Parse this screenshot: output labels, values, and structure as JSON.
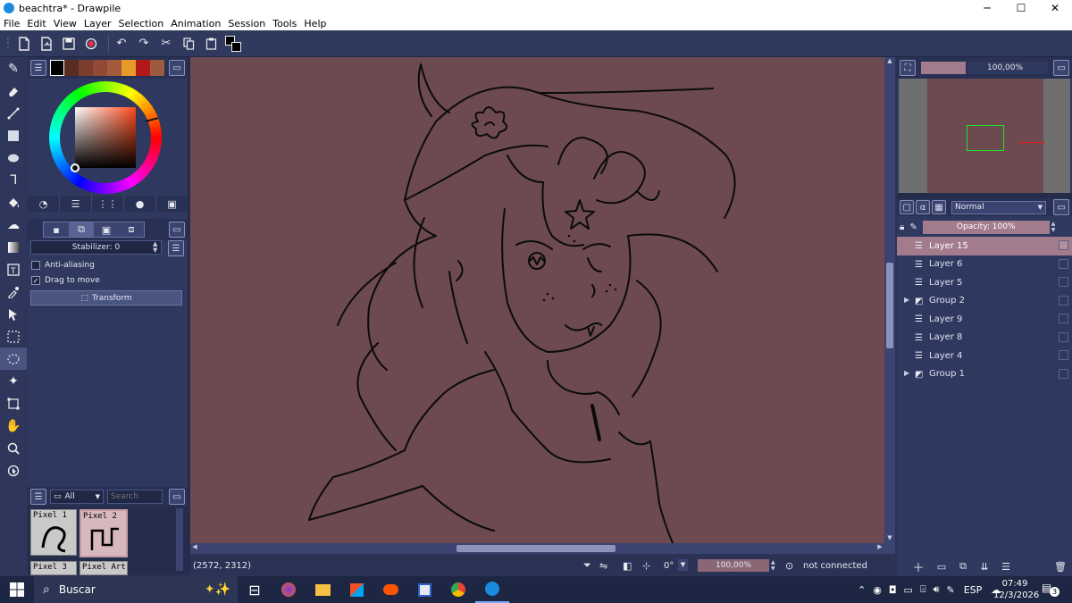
{
  "window": {
    "title": "beachtra* - Drawpile",
    "minimize": "─",
    "maximize": "☐",
    "close": "✕"
  },
  "menu": [
    "File",
    "Edit",
    "View",
    "Layer",
    "Selection",
    "Animation",
    "Session",
    "Tools",
    "Help"
  ],
  "palette_colors": [
    "#000000",
    "#5a2d24",
    "#7a3d2e",
    "#924a36",
    "#a55a3b",
    "#e59a2a",
    "#b31818",
    "#9c5a3e"
  ],
  "brush_panel": {
    "stabilizer": "Stabilizer: 0",
    "anti_aliasing": "Anti-aliasing",
    "drag_to_move": "Drag to move",
    "transform": "Transform"
  },
  "brushes_panel": {
    "filter": "All",
    "search_placeholder": "Search",
    "presets": [
      "Pixel 1",
      "Pixel 2",
      "Pixel 3",
      "Pixel Art"
    ]
  },
  "navigator": {
    "zoom": "100,00%"
  },
  "layers_panel": {
    "blend_mode": "Normal",
    "opacity": "Opacity: 100%",
    "layers": [
      {
        "name": "Layer 15",
        "type": "layer",
        "selected": true
      },
      {
        "name": "Layer 6",
        "type": "layer",
        "selected": false
      },
      {
        "name": "Layer 5",
        "type": "layer",
        "selected": false
      },
      {
        "name": "Group 2",
        "type": "group",
        "selected": false
      },
      {
        "name": "Layer 9",
        "type": "layer",
        "selected": false
      },
      {
        "name": "Layer 8",
        "type": "layer",
        "selected": false
      },
      {
        "name": "Layer 4",
        "type": "layer",
        "selected": false
      },
      {
        "name": "Group 1",
        "type": "group",
        "selected": false
      }
    ]
  },
  "status": {
    "coordinates": "(2572, 2312)",
    "rotation": "0°",
    "zoom": "100,00%",
    "connection": "not connected"
  },
  "taskbar": {
    "search_placeholder": "Buscar",
    "language": "ESP",
    "time": "07:49",
    "date": "12/3/2026",
    "notifications": "3"
  },
  "colors": {
    "canvas": "#6c4a50",
    "panel": "#2f3960",
    "selected_layer": "#a27c8c",
    "accent_blue": "#1b8be0"
  }
}
